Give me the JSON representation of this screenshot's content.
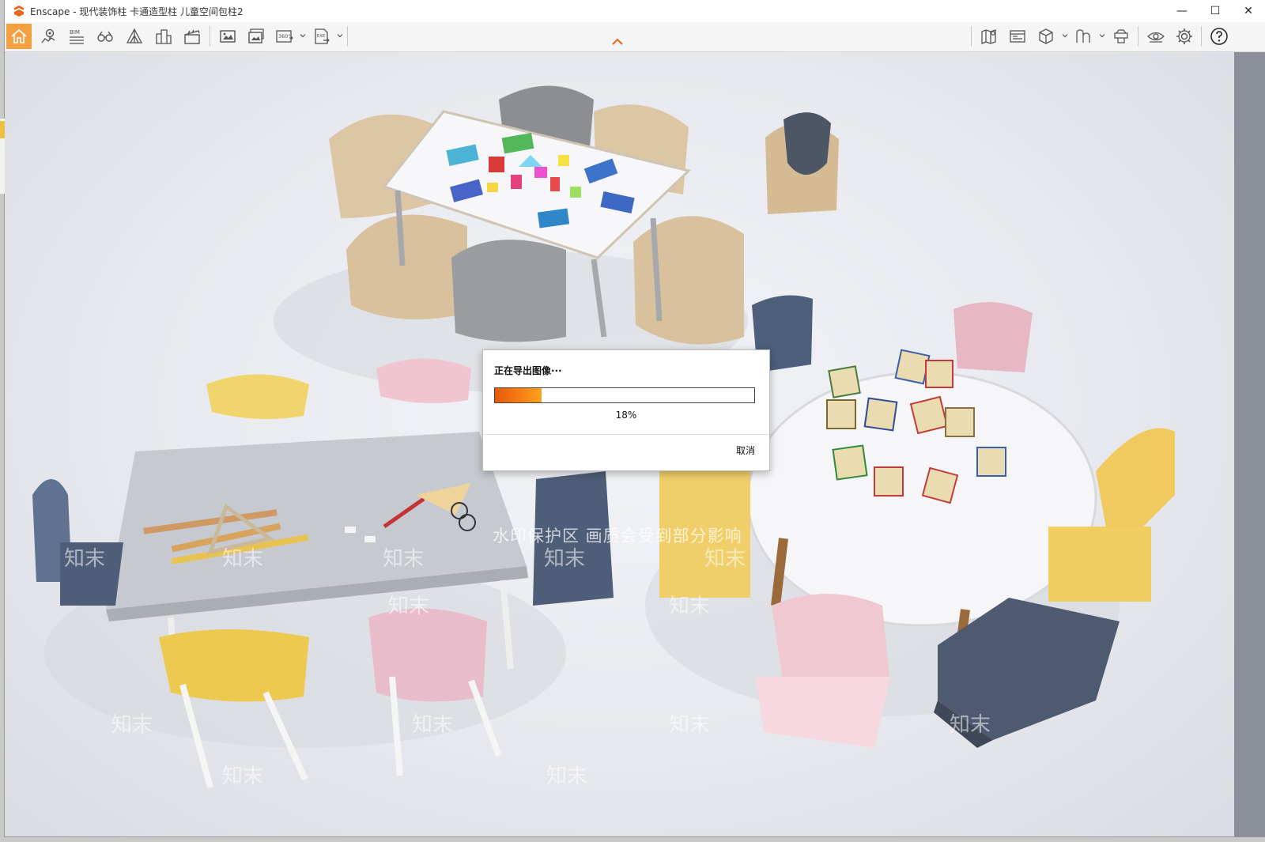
{
  "window": {
    "title": "Enscape - 现代装饰柱 卡通造型柱 儿童空间包柱2",
    "controls": {
      "minimize": "—",
      "maximize": "☐",
      "close": "✕"
    }
  },
  "toolbar": {
    "bim_label": "BIM",
    "video_360_label": "360°",
    "exe_label": "EXE",
    "left_tools": [
      {
        "name": "home-icon",
        "active": true
      },
      {
        "name": "location-pin-icon"
      },
      {
        "name": "bim-icon"
      },
      {
        "name": "binoculars-icon"
      },
      {
        "name": "perspective-icon"
      },
      {
        "name": "buildings-icon"
      },
      {
        "name": "clapper-icon"
      },
      {
        "name": "render-image-icon"
      },
      {
        "name": "batch-render-icon"
      },
      {
        "name": "panorama-360-icon"
      },
      {
        "name": "export-exe-icon"
      }
    ],
    "right_tools": [
      {
        "name": "map-icon"
      },
      {
        "name": "atmosphere-icon"
      },
      {
        "name": "cube-icon"
      },
      {
        "name": "asset-library-icon"
      },
      {
        "name": "capture-icon"
      },
      {
        "name": "eye-icon"
      },
      {
        "name": "settings-gear-icon"
      },
      {
        "name": "help-icon"
      }
    ],
    "accent_color": "#f5a142"
  },
  "dialog": {
    "title": "正在导出图像···",
    "progress_percent": 18,
    "progress_text": "18%",
    "cancel_label": "取消"
  },
  "watermark": {
    "banner": "水印保护区 画质会受到部分影响",
    "tile_text": "知末"
  }
}
